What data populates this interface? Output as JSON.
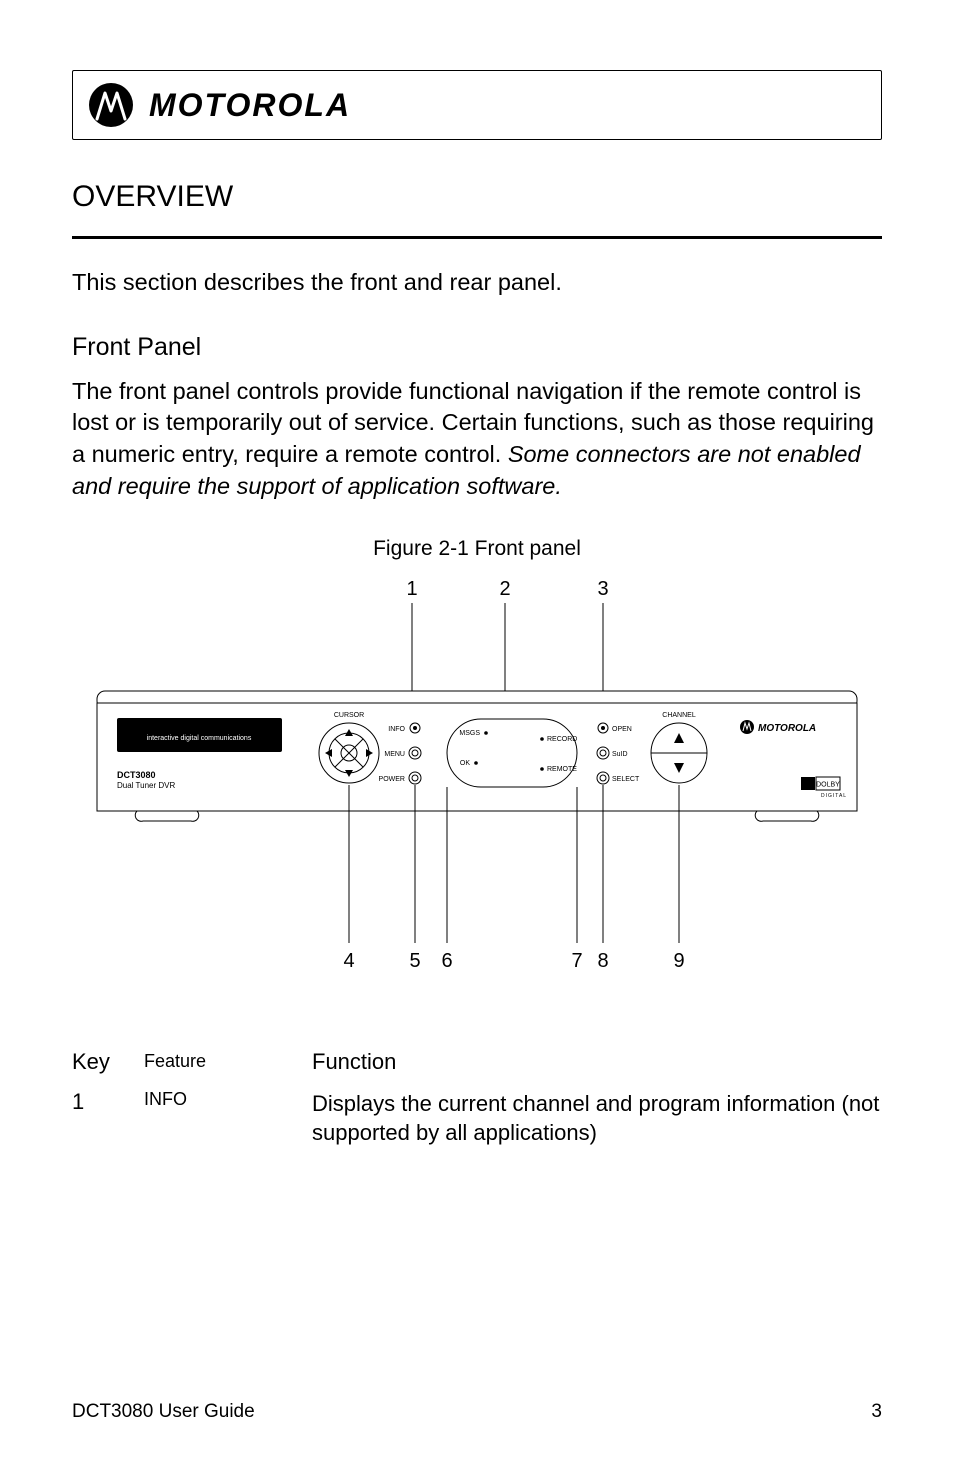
{
  "header": {
    "brand": "MOTOROLA"
  },
  "section_title": "OVERVIEW",
  "intro": "This section describes the front and rear panel.",
  "front_panel": {
    "title": "Front Panel",
    "para_plain": "The front panel controls provide functional navigation if the remote control is lost or is temporarily out of service. Certain functions, such as those requiring a numeric entry, require a remote control. ",
    "para_italic": "Some connectors are not enabled and require the support of application software."
  },
  "figure": {
    "caption": "Figure 2-1 Front panel",
    "callouts_top": [
      "1",
      "2",
      "3"
    ],
    "callouts_bottom": [
      "4",
      "5",
      "6",
      "7",
      "8",
      "9"
    ],
    "device_brand": "MOTOROLA",
    "device_model_line1": "DCT3080",
    "device_model_line2": "Dual Tuner DVR",
    "display_text": "interactive digital communications",
    "labels": {
      "cursor": "CURSOR",
      "info": "INFO",
      "menu": "MENU",
      "power": "POWER",
      "msgs": "MSGS",
      "ok": "OK",
      "record": "RECORD",
      "remote": "REMOTE",
      "open": "OPEN",
      "suid": "SuID",
      "select": "SELECT",
      "channel": "CHANNEL"
    },
    "dolby": "DOLBY"
  },
  "table": {
    "headers": {
      "key": "Key",
      "feature": "Feature",
      "function": "Function"
    },
    "rows": [
      {
        "key": "1",
        "feature": "INFO",
        "function": "Displays the current channel and program information (not supported by all applications)"
      }
    ]
  },
  "footer": {
    "left": "DCT3080 User Guide",
    "right": "3"
  }
}
